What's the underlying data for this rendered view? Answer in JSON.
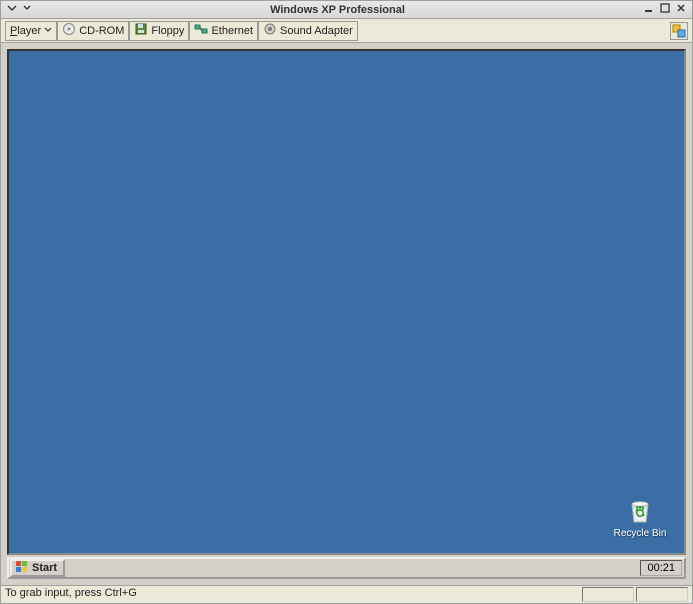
{
  "window": {
    "title": "Windows XP Professional"
  },
  "toolbar": {
    "player_label": "Player",
    "cdrom_label": "CD-ROM",
    "floppy_label": "Floppy",
    "ethernet_label": "Ethernet",
    "sound_label": "Sound Adapter"
  },
  "desktop": {
    "recycle_bin_label": "Recycle Bin"
  },
  "taskbar": {
    "start_label": "Start",
    "clock": "00:21"
  },
  "statusbar": {
    "message": "To grab input, press Ctrl+G"
  }
}
